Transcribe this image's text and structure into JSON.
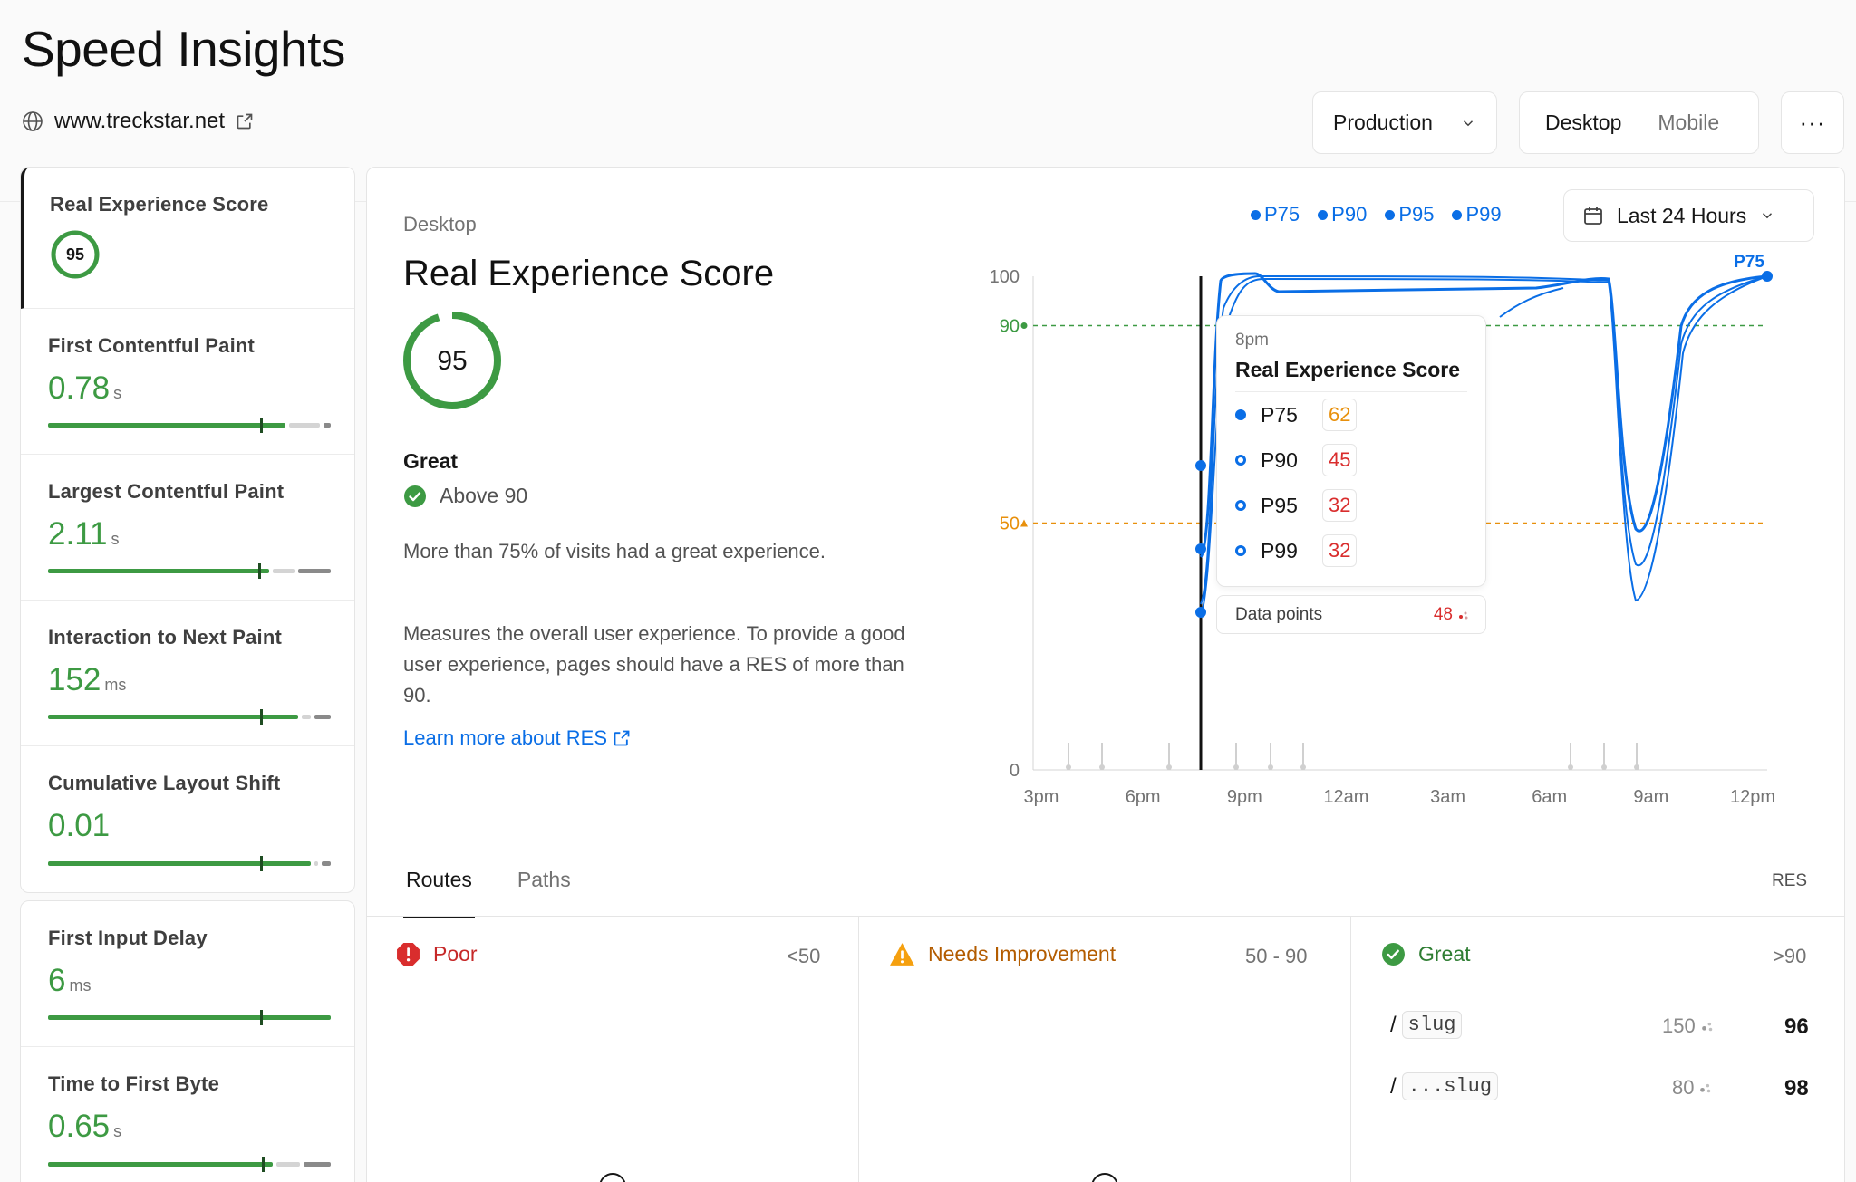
{
  "page": {
    "title": "Speed Insights",
    "site_url": "www.treckstar.net",
    "environment": "Production",
    "device_tabs": [
      "Desktop",
      "Mobile"
    ],
    "more_label": "···"
  },
  "metrics": [
    {
      "name": "Real Experience Score",
      "score": "95"
    },
    {
      "name": "First Contentful Paint",
      "value": "0.78",
      "unit": "s"
    },
    {
      "name": "Largest Contentful Paint",
      "value": "2.11",
      "unit": "s"
    },
    {
      "name": "Interaction to Next Paint",
      "value": "152",
      "unit": "ms"
    },
    {
      "name": "Cumulative Layout Shift",
      "value": "0.01",
      "unit": ""
    },
    {
      "name": "First Input Delay",
      "value": "6",
      "unit": "ms"
    },
    {
      "name": "Time to First Byte",
      "value": "0.65",
      "unit": "s"
    }
  ],
  "detail": {
    "device": "Desktop",
    "title": "Real Experience Score",
    "score": "95",
    "rating": "Great",
    "rating_sub": "Above 90",
    "summary": "More than 75% of visits had a great experience.",
    "description": "Measures the overall user experience. To provide a good user experience, pages should have a RES of more than 90.",
    "learn_more": "Learn more about RES"
  },
  "legend": [
    "P75",
    "P90",
    "P95",
    "P99"
  ],
  "time_range": "Last 24 Hours",
  "chart_data": {
    "type": "line",
    "x": [
      "3pm",
      "6pm",
      "9pm",
      "12am",
      "3am",
      "6am",
      "9am",
      "12pm"
    ],
    "yticks": [
      "100",
      "90",
      "50",
      "0"
    ],
    "ylim": [
      0,
      100
    ],
    "thresholds": [
      {
        "value": 90,
        "color": "#3d9a43"
      },
      {
        "value": 50,
        "color": "#e8900c"
      }
    ],
    "end_label": "P75",
    "color": "#0a6ee6"
  },
  "tooltip": {
    "time": "8pm",
    "title": "Real Experience Score",
    "rows": [
      {
        "name": "P75",
        "value": "62"
      },
      {
        "name": "P90",
        "value": "45"
      },
      {
        "name": "P95",
        "value": "32"
      },
      {
        "name": "P99",
        "value": "32"
      }
    ],
    "data_points_label": "Data points",
    "data_points_value": "48"
  },
  "tabs": [
    "Routes",
    "Paths"
  ],
  "res_label": "RES",
  "columns": [
    {
      "label": "Poor",
      "range": "<50",
      "color": "#c62828"
    },
    {
      "label": "Needs Improvement",
      "range": "50 - 90",
      "color": "#b35c00"
    },
    {
      "label": "Great",
      "range": ">90",
      "color": "#2e7d32"
    }
  ],
  "routes": [
    {
      "prefix": "/",
      "path": "slug",
      "count": "150",
      "score": "96"
    },
    {
      "prefix": "/",
      "path": "...slug",
      "count": "80",
      "score": "98"
    }
  ]
}
